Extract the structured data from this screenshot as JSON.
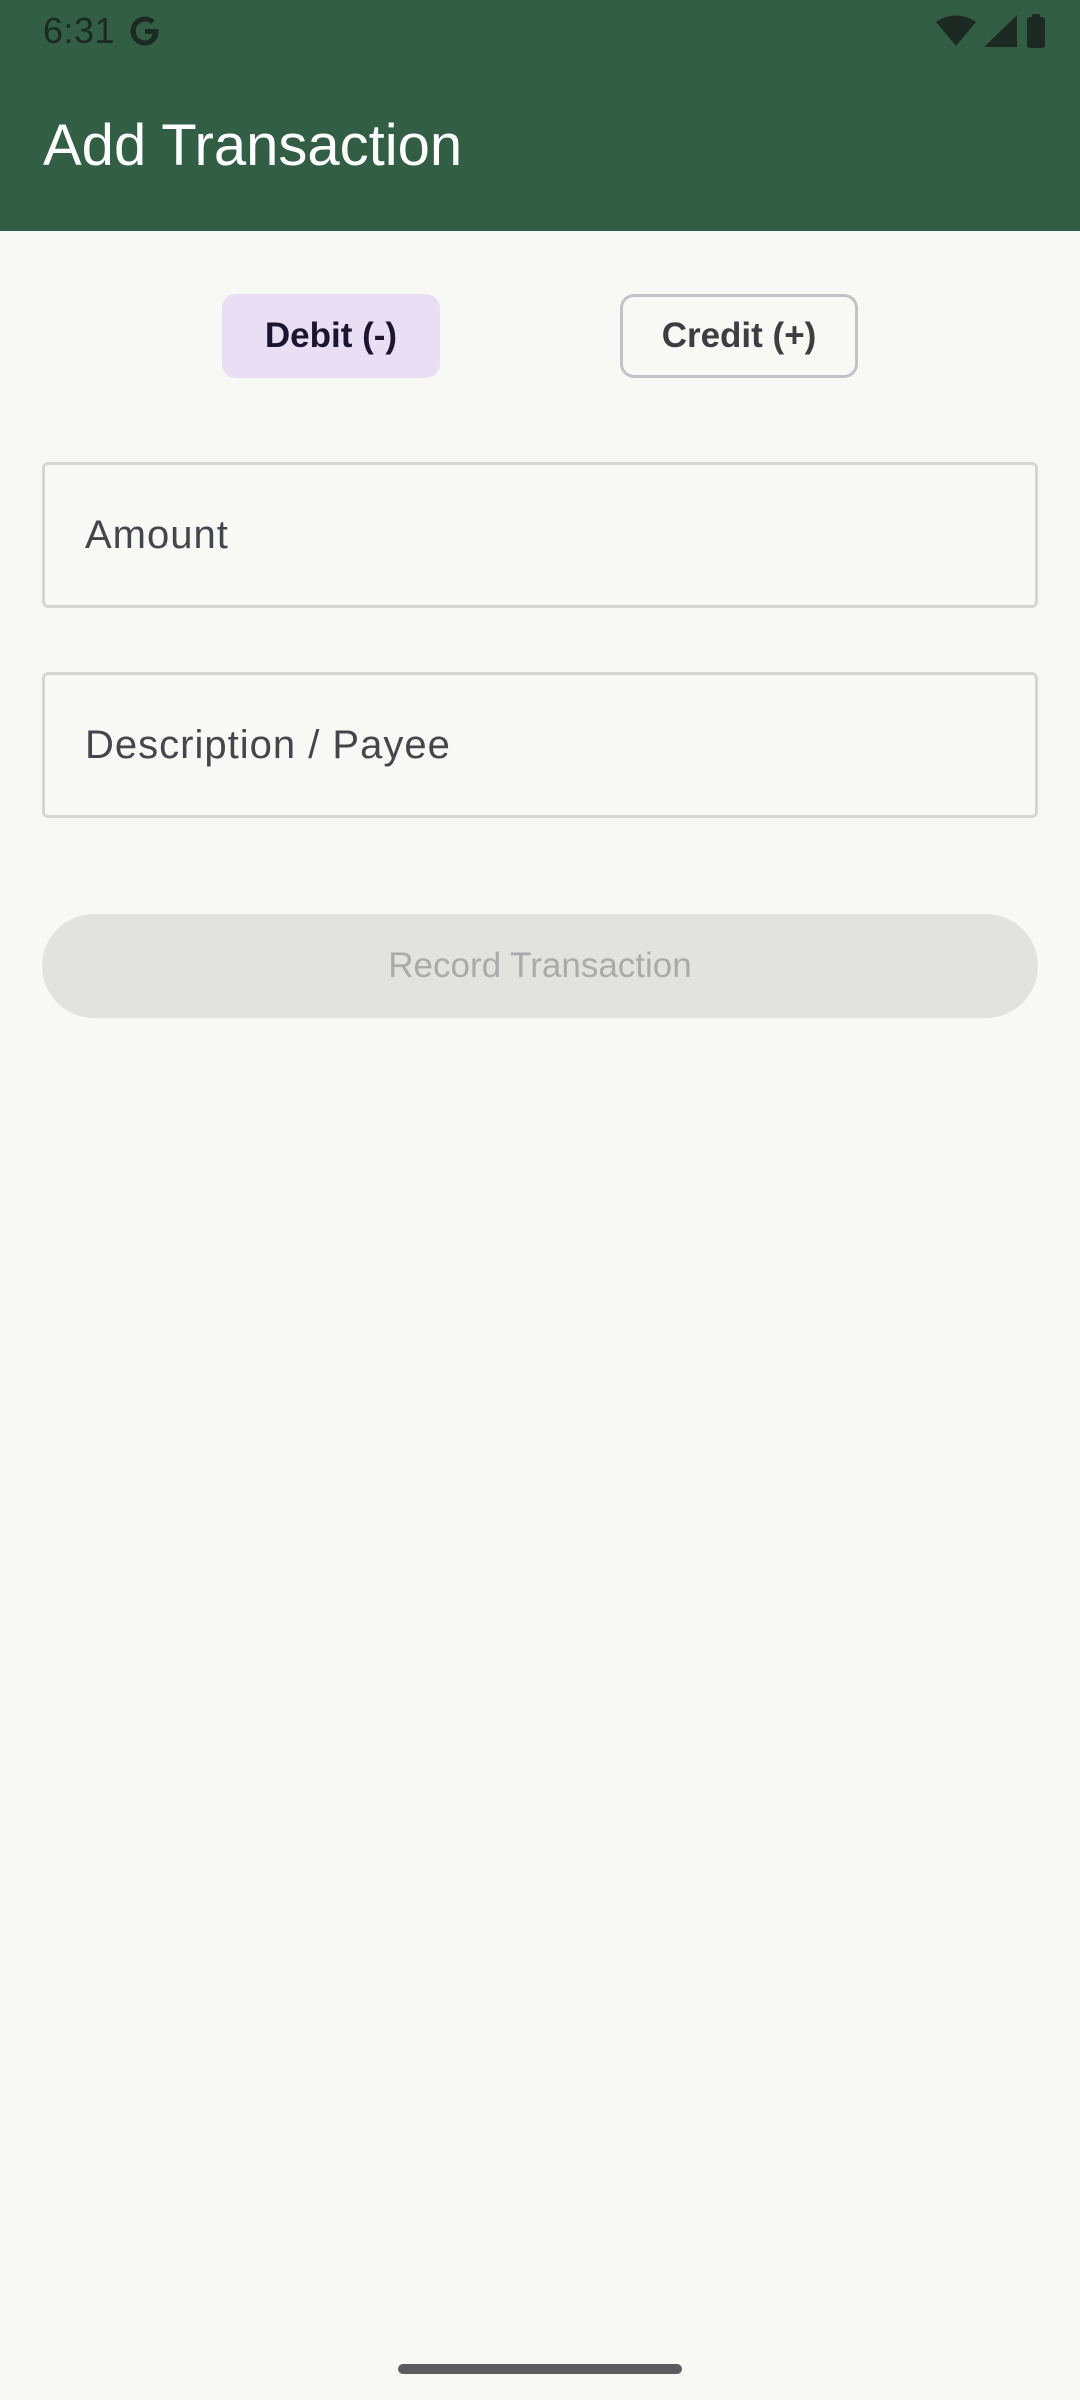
{
  "status_bar": {
    "time": "6:31",
    "icons": [
      "google-g-icon",
      "wifi-icon",
      "cell-signal-icon",
      "battery-icon"
    ]
  },
  "app_bar": {
    "title": "Add Transaction",
    "background_color": "#325e45"
  },
  "type_toggle": {
    "options": [
      {
        "label": "Debit (-)",
        "selected": true
      },
      {
        "label": "Credit (+)",
        "selected": false
      }
    ],
    "selected_color": "#e8dff5"
  },
  "form": {
    "amount_label": "Amount",
    "description_label": "Description / Payee"
  },
  "actions": {
    "record_label": "Record Transaction",
    "record_enabled": false
  }
}
